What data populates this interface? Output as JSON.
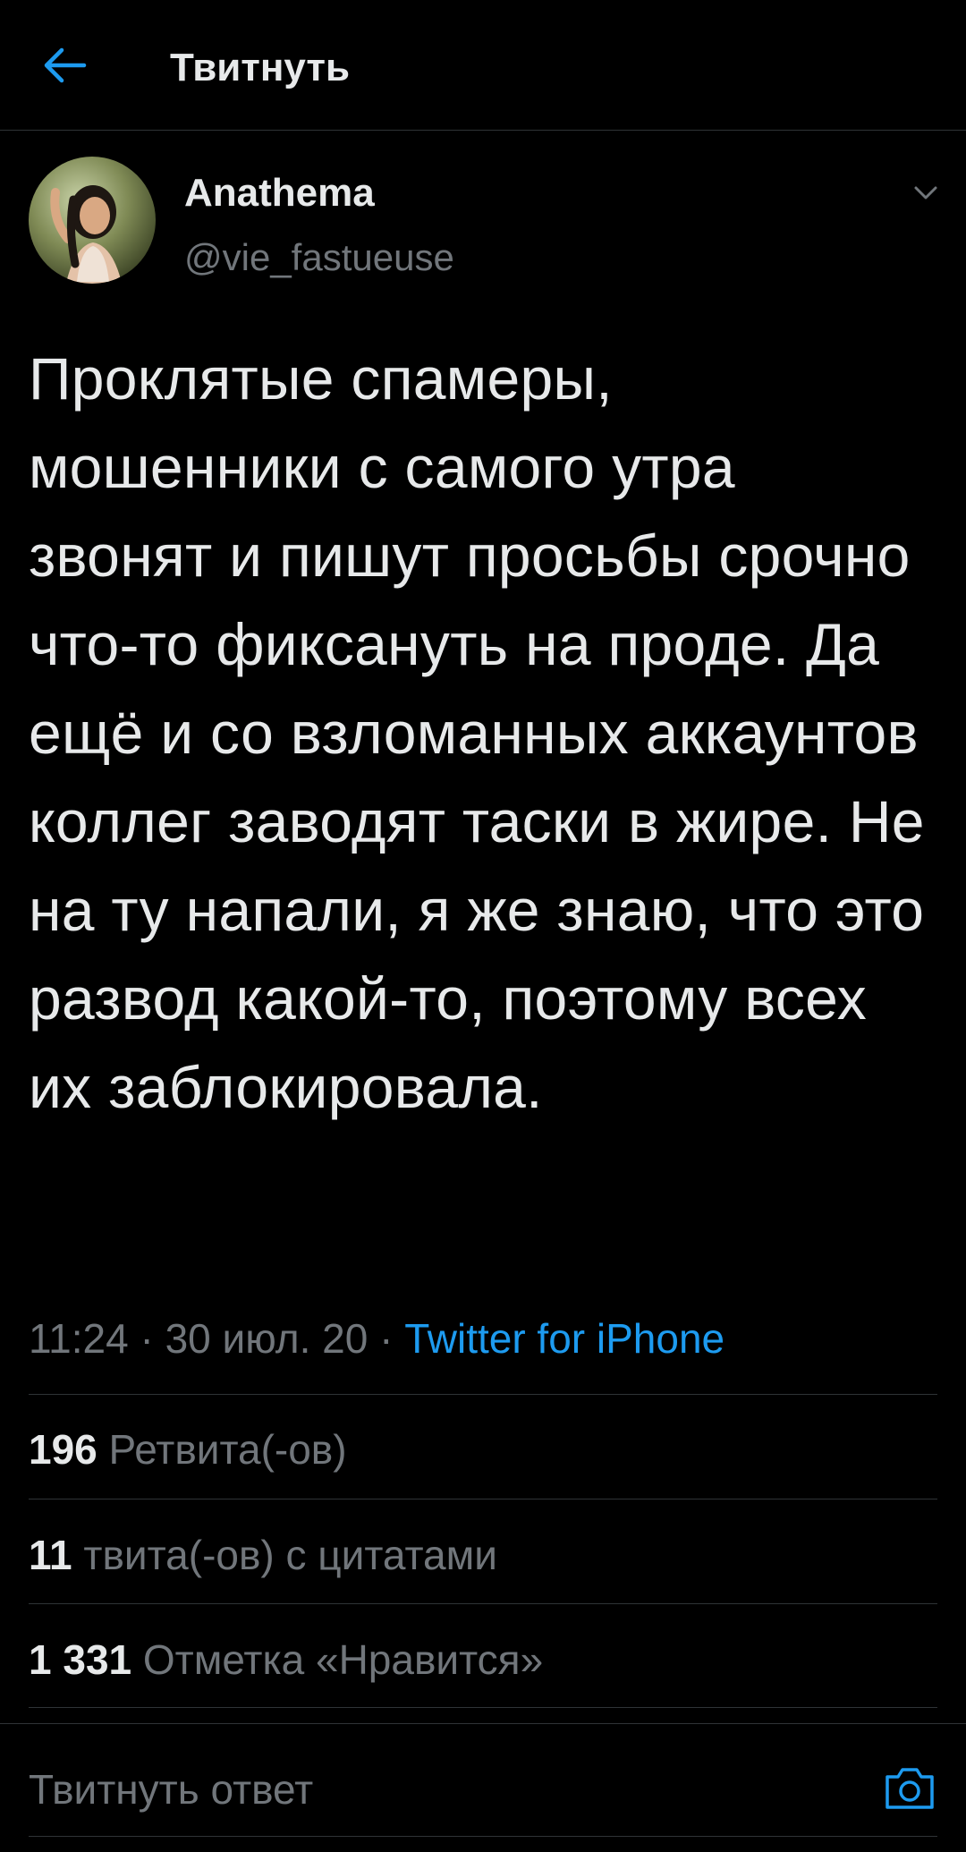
{
  "header": {
    "title": "Твитнуть"
  },
  "tweet": {
    "author": {
      "display_name": "Anathema",
      "handle": "@vie_fastueuse"
    },
    "text": "Проклятые спамеры, мошенники с самого утра звонят и пишут просьбы срочно что-то фиксануть на проде. Да ещё и со взломанных аккаунтов коллег заводят таски в жире. Не на ту напали, я же знаю, что это развод какой-то, поэтому всех их заблокировала.",
    "time": "11:24",
    "date": "30 июл. 20",
    "separator": " · ",
    "source": "Twitter for iPhone"
  },
  "stats": [
    {
      "count": "196",
      "label": "Ретвита(-ов)"
    },
    {
      "count": "11",
      "label": "твита(-ов) с цитатами"
    },
    {
      "count": "1 331",
      "label": "Отметка «Нравится»"
    }
  ],
  "reply": {
    "placeholder": "Твитнуть ответ"
  },
  "icons": {
    "back": "arrow-left-icon",
    "more": "chevron-down-icon",
    "camera": "camera-icon"
  },
  "colors": {
    "background": "#000000",
    "text": "#e7e9ea",
    "secondary": "#71767b",
    "accent": "#1d9bf0",
    "divider": "#2f3336"
  }
}
